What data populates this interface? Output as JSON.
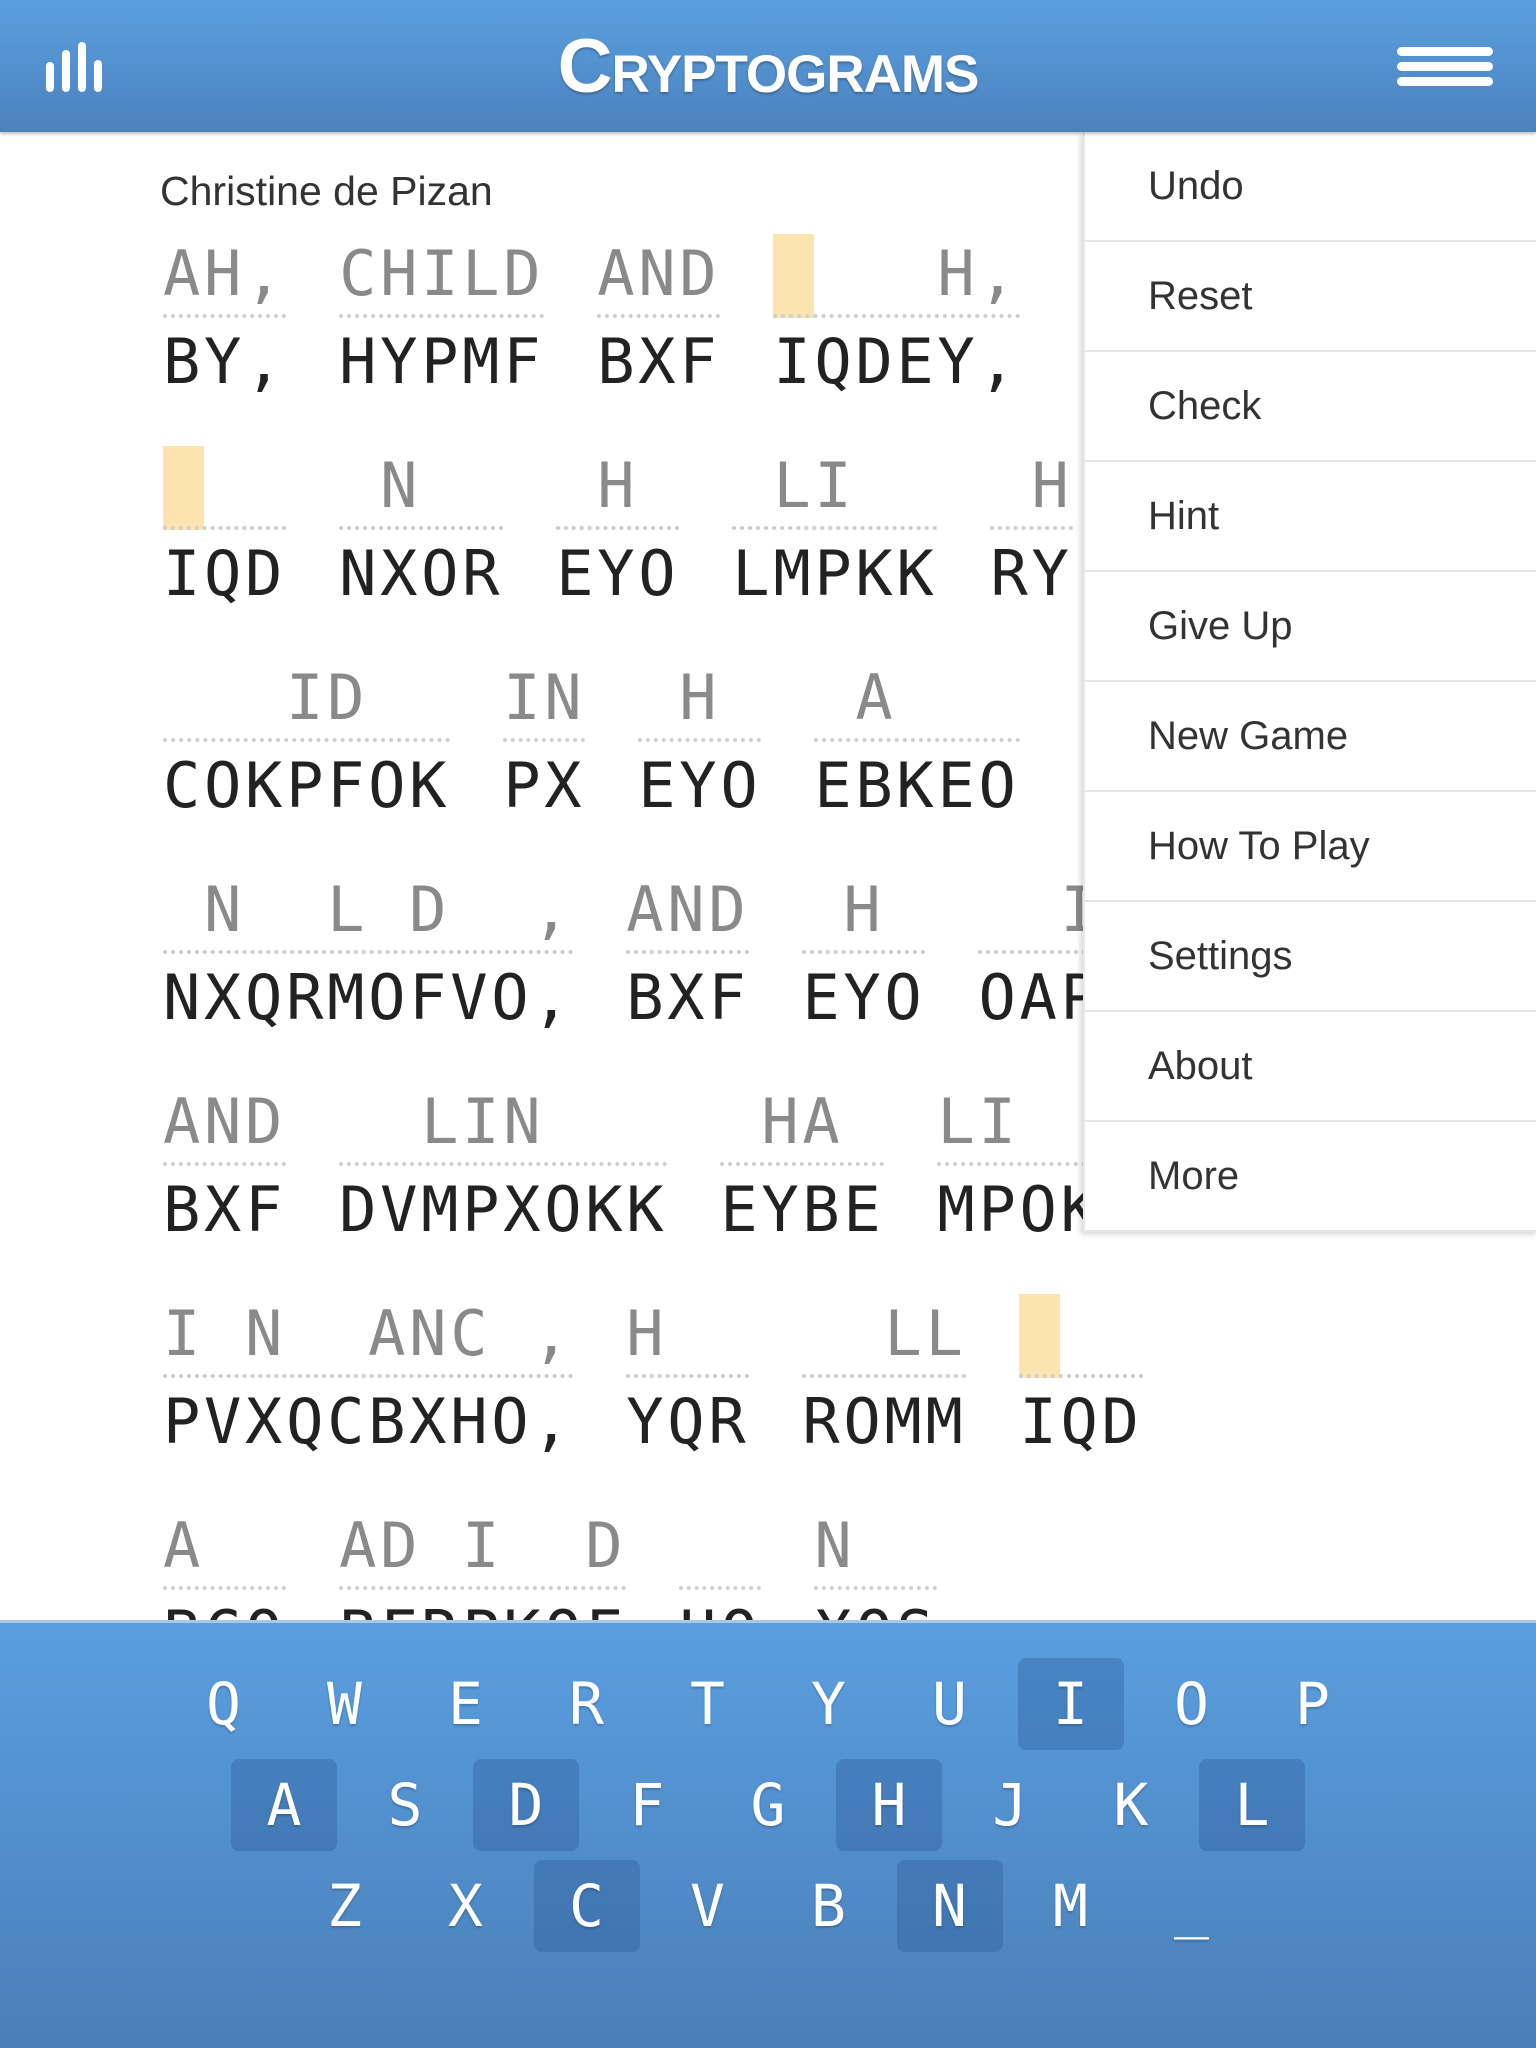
{
  "header": {
    "title": "Cryptograms",
    "left_icon": "stats-bars-icon",
    "right_icon": "hamburger-menu-icon"
  },
  "author": "Christine de Pizan",
  "puzzle": {
    "highlight_color": "#fde3ae",
    "rows": [
      [
        {
          "plain": "AH,",
          "cipher": "BY,"
        },
        {
          "plain": "CHILD",
          "cipher": "HYPMF"
        },
        {
          "plain": "AND",
          "cipher": "BXF"
        },
        {
          "plain": "    H,",
          "cipher": "IQDEY,",
          "selected_cell": 0
        }
      ],
      [
        {
          "plain": "   ",
          "cipher": "IQD",
          "selected_cell": 0
        },
        {
          "plain": " N  ",
          "cipher": "NXOR"
        },
        {
          "plain": " H ",
          "cipher": "EYO"
        },
        {
          "plain": " LI  ",
          "cipher": "LMPKK"
        },
        {
          "plain": " H",
          "cipher": "RY"
        }
      ],
      [
        {
          "plain": "   ID  ",
          "cipher": "COKPFOK"
        },
        {
          "plain": "IN",
          "cipher": "PX"
        },
        {
          "plain": " H ",
          "cipher": "EYO"
        },
        {
          "plain": " A   ",
          "cipher": "EBKEO"
        }
      ],
      [
        {
          "plain": " N  L D  ,",
          "cipher": "NXQRMOFVO,"
        },
        {
          "plain": "AND",
          "cipher": "BXF"
        },
        {
          "plain": " H ",
          "cipher": "EYO"
        },
        {
          "plain": "  I",
          "cipher": "OAP"
        }
      ],
      [
        {
          "plain": "AND",
          "cipher": "BXF"
        },
        {
          "plain": "  LIN   ",
          "cipher": "DVMPXOKK"
        },
        {
          "plain": " HA ",
          "cipher": "EYBE"
        },
        {
          "plain": "LI  ",
          "cipher": "MPOK"
        }
      ],
      [
        {
          "plain": "I N  ANC ,",
          "cipher": "PVXQCBXHO,"
        },
        {
          "plain": "H  ",
          "cipher": "YQR"
        },
        {
          "plain": "  LL",
          "cipher": "ROMM"
        },
        {
          "plain": "   ",
          "cipher": "IQD",
          "selected_cell": 0
        }
      ],
      [
        {
          "plain": "A  ",
          "cipher": "BCO"
        },
        {
          "plain": "AD I  D",
          "cipher": "BFRPKOF"
        },
        {
          "plain": "  ",
          "cipher": "UO"
        },
        {
          "plain": "N  ",
          "cipher": "XOS"
        }
      ]
    ]
  },
  "menu": {
    "items": [
      "Undo",
      "Reset",
      "Check",
      "Hint",
      "Give Up",
      "New Game",
      "How To Play",
      "Settings",
      "About",
      "More"
    ]
  },
  "keyboard": {
    "rows": [
      [
        "Q",
        "W",
        "E",
        "R",
        "T",
        "Y",
        "U",
        "I",
        "O",
        "P"
      ],
      [
        "A",
        "S",
        "D",
        "F",
        "G",
        "H",
        "J",
        "K",
        "L"
      ],
      [
        "Z",
        "X",
        "C",
        "V",
        "B",
        "N",
        "M",
        "_"
      ]
    ],
    "used_letters": [
      "I",
      "A",
      "D",
      "H",
      "L",
      "C",
      "N"
    ]
  }
}
